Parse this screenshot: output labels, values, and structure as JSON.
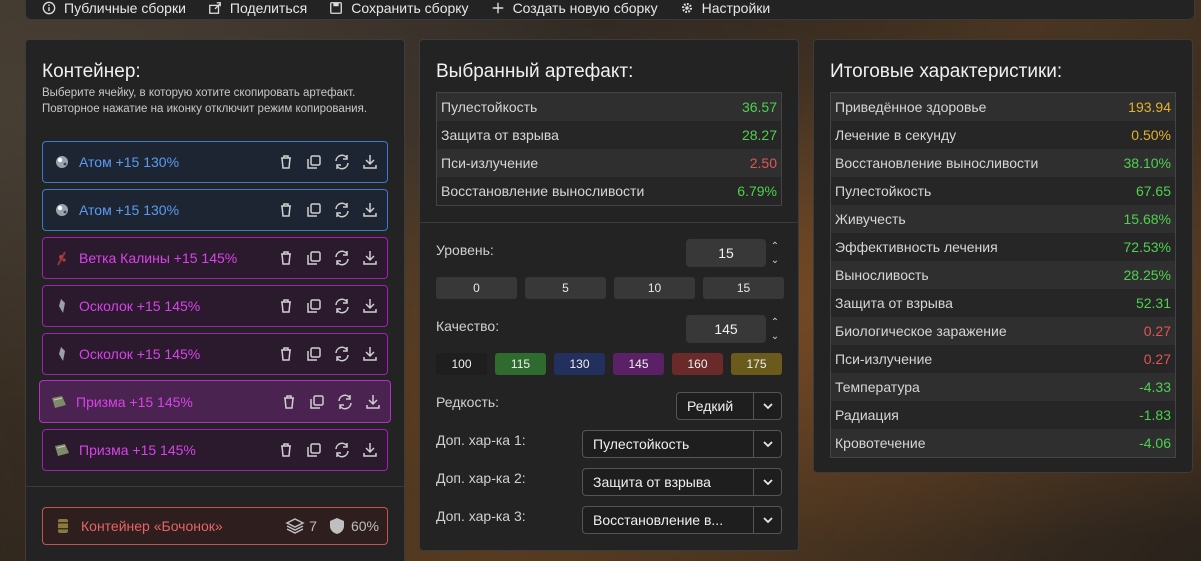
{
  "topbar": {
    "items": [
      {
        "label": "Публичные сборки",
        "icon": "info-icon"
      },
      {
        "label": "Поделиться",
        "icon": "share-icon"
      },
      {
        "label": "Сохранить сборку",
        "icon": "save-icon"
      },
      {
        "label": "Создать новую сборку",
        "icon": "plus-icon"
      },
      {
        "label": "Настройки",
        "icon": "gear-icon"
      }
    ]
  },
  "container": {
    "title": "Контейнер:",
    "hint": "Выберите ячейку, в которую хотите скопировать артефакт. Повторное нажатие на иконку отключит режим копирования.",
    "slots": [
      {
        "name": "Атом +15 130%",
        "color": "#5a9cf0"
      },
      {
        "name": "Атом +15 130%",
        "color": "#5a9cf0"
      },
      {
        "name": "Ветка Калины +15 145%",
        "color": "#d843e8"
      },
      {
        "name": "Осколок +15 145%",
        "color": "#d843e8"
      },
      {
        "name": "Осколок +15 145%",
        "color": "#d843e8"
      },
      {
        "name": "Призма +15 145%",
        "color": "#d843e8"
      },
      {
        "name": "Призма +15 145%",
        "color": "#d843e8"
      }
    ],
    "box": {
      "name": "Контейнер «Бочонок»",
      "capacity": "7",
      "protection": "60%"
    }
  },
  "artifact": {
    "title": "Выбранный артефакт:",
    "stats": [
      {
        "label": "Пулестойкость",
        "value": "36.57",
        "tone": "green"
      },
      {
        "label": "Защита от взрыва",
        "value": "28.27",
        "tone": "green"
      },
      {
        "label": "Пси-излучение",
        "value": "2.50",
        "tone": "red"
      },
      {
        "label": "Восстановление выносливости",
        "value": "6.79%",
        "tone": "green"
      }
    ],
    "level_label": "Уровень:",
    "level_value": "15",
    "level_presets": [
      "0",
      "5",
      "10",
      "15"
    ],
    "quality_label": "Качество:",
    "quality_value": "145",
    "quality_presets": [
      {
        "label": "100",
        "color": "#1e1e1e"
      },
      {
        "label": "115",
        "color": "#2f6a2f"
      },
      {
        "label": "130",
        "color": "#23305e"
      },
      {
        "label": "145",
        "color": "#5a2166"
      },
      {
        "label": "160",
        "color": "#6a2a2a"
      },
      {
        "label": "175",
        "color": "#6a5a1c"
      }
    ],
    "rarity_label": "Редкость:",
    "rarity_value": "Редкий",
    "extra1_label": "Доп. хар-ка 1:",
    "extra1_value": "Пулестойкость",
    "extra2_label": "Доп. хар-ка 2:",
    "extra2_value": "Защита от взрыва",
    "extra3_label": "Доп. хар-ка 3:",
    "extra3_value": "Восстановление в..."
  },
  "totals": {
    "title": "Итоговые характеристики:",
    "stats": [
      {
        "label": "Приведённое здоровье",
        "value": "193.94",
        "tone": "gold"
      },
      {
        "label": "Лечение в секунду",
        "value": "0.50%",
        "tone": "gold"
      },
      {
        "label": "Восстановление выносливости",
        "value": "38.10%",
        "tone": "green"
      },
      {
        "label": "Пулестойкость",
        "value": "67.65",
        "tone": "green"
      },
      {
        "label": "Живучесть",
        "value": "15.68%",
        "tone": "green"
      },
      {
        "label": "Эффективность лечения",
        "value": "72.53%",
        "tone": "green"
      },
      {
        "label": "Выносливость",
        "value": "28.25%",
        "tone": "green"
      },
      {
        "label": "Защита от взрыва",
        "value": "52.31",
        "tone": "green"
      },
      {
        "label": "Биологическое заражение",
        "value": "0.27",
        "tone": "red"
      },
      {
        "label": "Пси-излучение",
        "value": "0.27",
        "tone": "red"
      },
      {
        "label": "Температура",
        "value": "-4.33",
        "tone": "green"
      },
      {
        "label": "Радиация",
        "value": "-1.83",
        "tone": "green"
      },
      {
        "label": "Кровотечение",
        "value": "-4.06",
        "tone": "green"
      }
    ]
  }
}
